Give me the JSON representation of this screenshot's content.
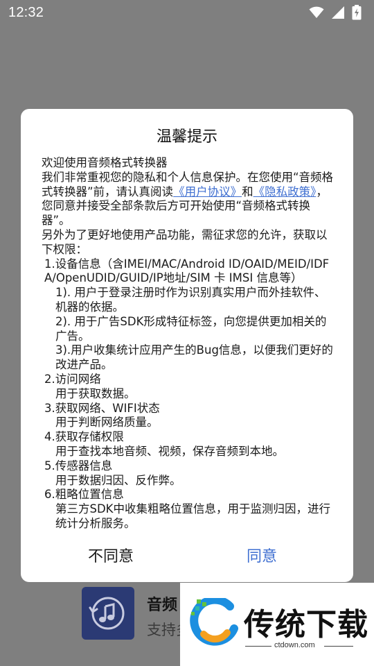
{
  "status_bar": {
    "time": "12:32",
    "icons": [
      "wifi-icon",
      "signal-icon",
      "battery-charging-icon"
    ]
  },
  "dialog": {
    "title": "温馨提示",
    "body": {
      "welcome": "欢迎使用音频格式转换器",
      "p1_pre": "我们非常重视您的隐私和个人信息保护。在您使用“音频格式转换器”前，请认真阅读",
      "link_user_agreement": "《用户协议》",
      "p1_and": "和",
      "link_privacy_policy": "《隐私政策》",
      "p1_post": "，您同意并接受全部条款后方可开始使用“音频格式转换器”。",
      "p2": "另外为了更好地使用产品功能，需征求您的允许，获取以下权限：",
      "item1_title": "1.设备信息（含IMEI/MAC/Android ID/OAID/MEID/IDFA/OpenUDID/GUID/IP地址/SIM 卡 IMSI 信息等）",
      "item1_sub1": "1). 用户于登录注册时作为识别真实用户而外挂软件、机器的依据。",
      "item1_sub2": "2). 用于广告SDK形成特征标签，向您提供更加相关的广告。",
      "item1_sub3": "3).用户收集统计应用产生的Bug信息，以便我们更好的改进产品。",
      "item2_title": "2.访问网络",
      "item2_desc": "用于获取数据。",
      "item3_title": "3.获取网络、WIFI状态",
      "item3_desc": "用于判断网络质量。",
      "item4_title": "4.获取存储权限",
      "item4_desc": "用于查找本地音频、视频，保存音频到本地。",
      "item5_title": "5.传感器信息",
      "item5_desc": "用于数据归因、反作弊。",
      "item6_title": "6.粗略位置信息",
      "item6_desc": "第三方SDK中收集粗略位置信息，用于监测归因，进行统计分析服务。"
    },
    "buttons": {
      "disagree": "不同意",
      "agree": "同意"
    }
  },
  "background_app": {
    "title": "音频",
    "subtitle": "支持多"
  },
  "watermark": {
    "brand": "传统下载",
    "url": "ctdown.com"
  },
  "colors": {
    "scrim": "#7f7f7f",
    "link": "#3f6fd1",
    "agree_button": "#3f6fd1",
    "app_icon_bg": "#2b3a74"
  }
}
